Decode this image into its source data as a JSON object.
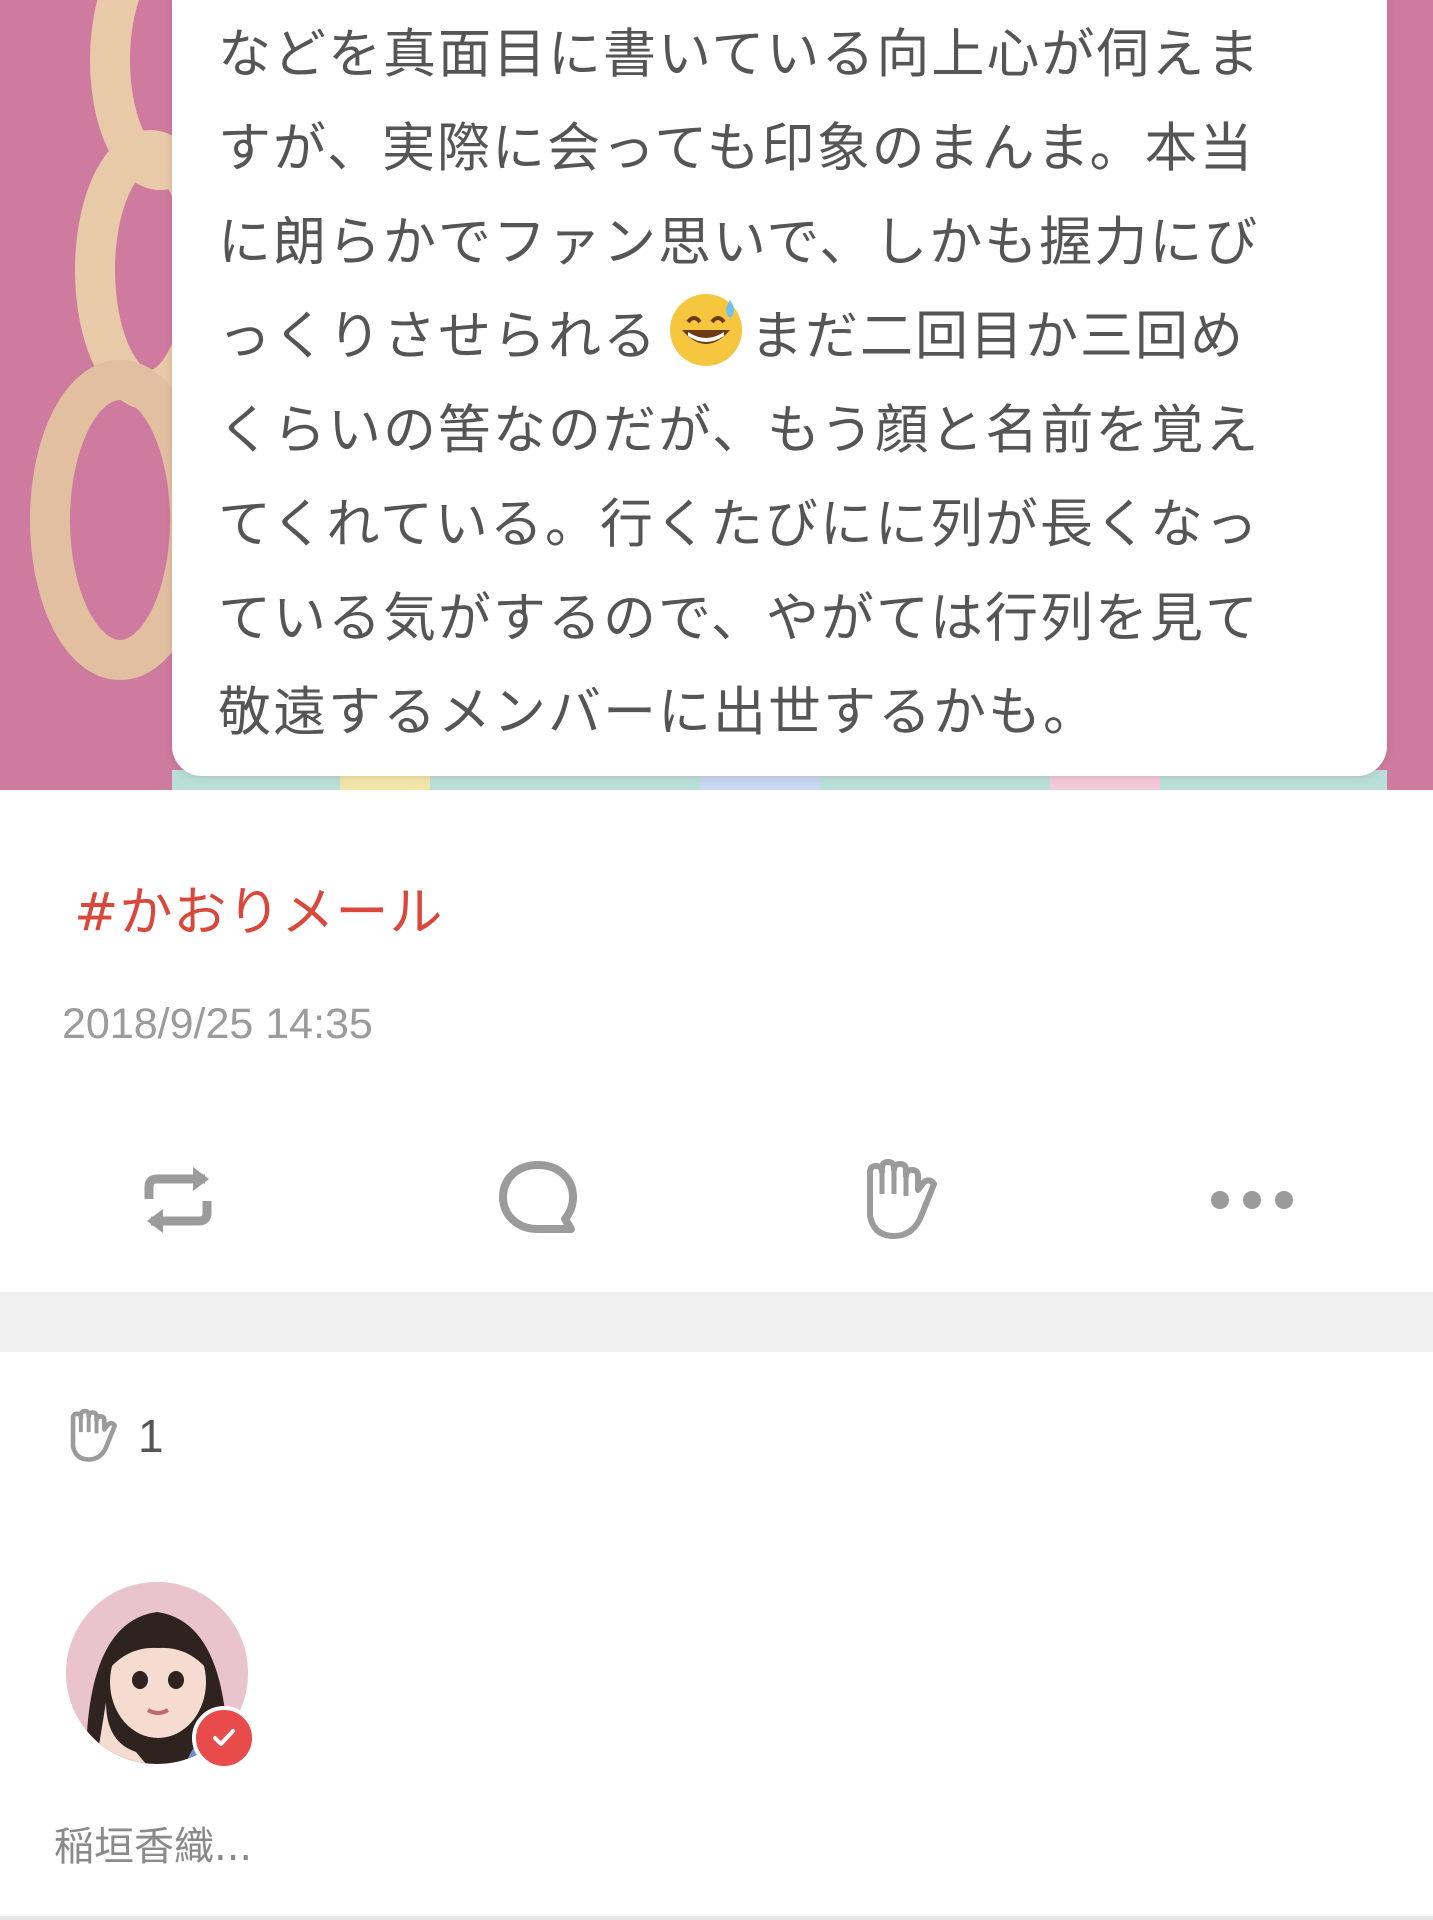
{
  "post": {
    "body_lines": [
      "などを真面目に書いている向上心が伺えま",
      "すが、実際に会っても印象のまんま。本当",
      "に朗らかでファン思いで、しかも握力にび",
      "っくりさせられる",
      "まだ二回目か三回め",
      "くらいの筈なのだが、もう顔と名前を覚え",
      "てくれている。行くたびにに列が長くなっ",
      "ている気がするので、やがては行列を見て",
      "敬遠するメンバーに出世するかも。"
    ],
    "emoji_name": "grinning-face-with-sweat-emoji",
    "hashtag": "#かおりメール",
    "timestamp": "2018/9/25 14:35"
  },
  "actions": {
    "repost_icon": "repost-icon",
    "comment_icon": "comment-bubble-icon",
    "clap_icon": "clap-hand-icon",
    "more_icon": "more-dots-icon"
  },
  "claps": {
    "count": "1",
    "users": [
      {
        "name": "稲垣香織...",
        "verified": true
      }
    ]
  },
  "colors": {
    "hashtag": "#d9483b",
    "image_background": "#cf7a9f",
    "body_text": "#555555",
    "timestamp": "#9b9b9b",
    "icon_gray": "#9b9b9b",
    "verified_badge": "#e94b4b"
  }
}
